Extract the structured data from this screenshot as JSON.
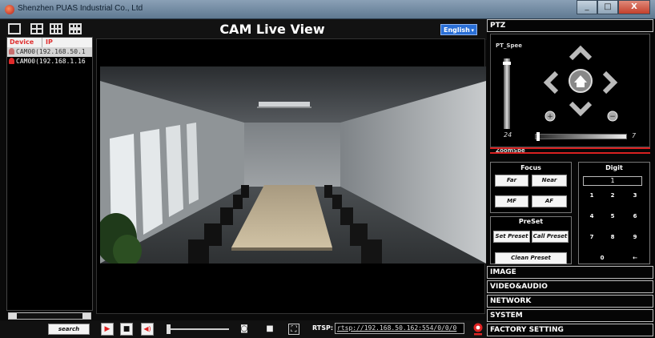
{
  "titlebar": {
    "title": "Shenzhen PUAS Industrial Co., Ltd",
    "min": "_",
    "max": "□",
    "close": "X"
  },
  "header": {
    "title": "CAM Live View",
    "language": "English"
  },
  "devices": {
    "col_device": "Device",
    "col_ip": "IP",
    "rows": [
      {
        "name": "CAM00(192.168.50.1"
      },
      {
        "name": "CAM00(192.168.1.16"
      }
    ]
  },
  "bottombar": {
    "search_label": "search device",
    "rtsp_label": "RTSP:",
    "rtsp_url": "rtsp://192.168.50.162:554/0/0/0"
  },
  "ptz": {
    "header": "PTZ",
    "speed_label": "PT_Spee",
    "speed_value": "24",
    "zoom_label": "ZoomSpe",
    "zoom_value": "7"
  },
  "focus": {
    "title": "Focus",
    "far": "Far",
    "near": "Near",
    "mf": "MF",
    "af": "AF"
  },
  "preset": {
    "title": "PreSet",
    "set": "Set Preset",
    "call": "Call Preset",
    "clean": "Clean Preset"
  },
  "digit": {
    "title": "Digit",
    "display": "1",
    "keys": [
      "1",
      "2",
      "3",
      "4",
      "5",
      "6",
      "7",
      "8",
      "9",
      "0",
      "←"
    ]
  },
  "sections": [
    "IMAGE",
    "VIDEO&AUDIO",
    "NETWORK",
    "SYSTEM",
    "FACTORY SETTING"
  ],
  "colors": {
    "accent_red": "#d82020",
    "lang_blue": "#2a6fd6"
  }
}
